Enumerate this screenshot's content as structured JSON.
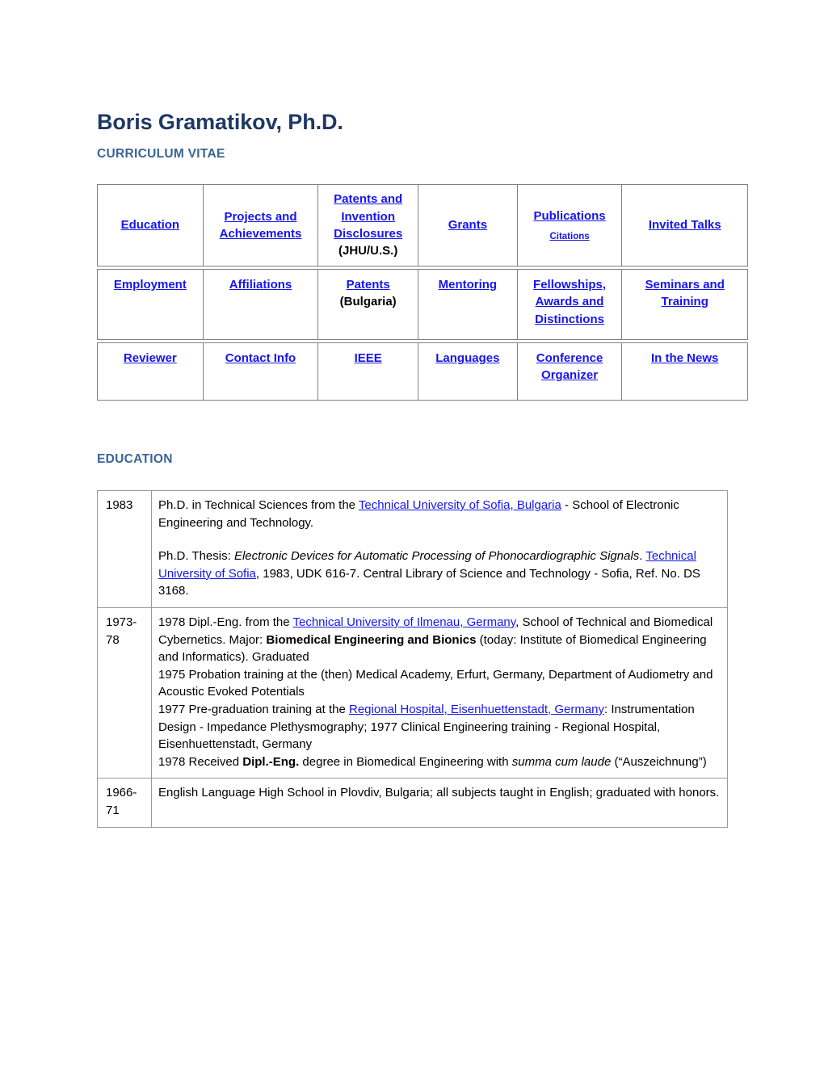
{
  "document": {
    "title": "Boris Gramatikov, Ph.D.",
    "subtitle": "CURRICULUM VITAE"
  },
  "nav_table": {
    "rows": [
      {
        "cells": [
          {
            "link": "Education"
          },
          {
            "link": "Projects and Achievements"
          },
          {
            "link": "Patents and Invention Disclosures",
            "sub": "(JHU/U.S.)"
          },
          {
            "link": "Grants"
          },
          {
            "link": "Publications",
            "small_link": "Citations"
          },
          {
            "link": "Invited Talks"
          }
        ]
      },
      {
        "cells": [
          {
            "link": "Employment"
          },
          {
            "link": "Affiliations"
          },
          {
            "link": "Patents",
            "sub": "(Bulgaria)"
          },
          {
            "link": "Mentoring"
          },
          {
            "link": "Fellowships, Awards and Distinctions"
          },
          {
            "link": "Seminars and Training"
          }
        ]
      },
      {
        "cells": [
          {
            "link": "Reviewer"
          },
          {
            "link": "Contact Info"
          },
          {
            "link": "IEEE"
          },
          {
            "link": "Languages"
          },
          {
            "link": "Conference Organizer"
          },
          {
            "link": "In the News"
          }
        ]
      }
    ]
  },
  "education": {
    "heading": "EDUCATION",
    "rows": [
      {
        "year": "1983",
        "para1": {
          "t1": "Ph.D. in Technical Sciences from the ",
          "link1": "Technical University of Sofia, Bulgaria",
          "t2": " - School of Electronic Engineering and Technology."
        },
        "para2": {
          "t1": "Ph.D. Thesis: ",
          "italic1": "Electronic Devices for Automatic Processing of Phonocardiographic Signals",
          "t2": ". ",
          "link1": "Technical University of Sofia",
          "t3": ", 1983, UDK 616-7. Central Library of Science and Technology - Sofia, Ref. No. DS 3168."
        }
      },
      {
        "year": "1973-78",
        "line1": {
          "t1": "  1978   Dipl.-Eng. from the ",
          "link1": "Technical University of Ilmenau, Germany",
          "t2": ", School of Technical and Biomedical Cybernetics. Major: ",
          "bold1": "Biomedical Engineering and Bionics",
          "t3": " (today: Institute of Biomedical Engineering and Informatics).  Graduated"
        },
        "line2": {
          "t1": "1975    Probation training at the (then) Medical Academy, Erfurt, Germany, Department of Audiometry and Acoustic Evoked Potentials"
        },
        "line3": {
          "t1": "  1977    Pre-graduation training at the ",
          "link1": "Regional Hospital, Eisenhuettenstadt, Germany",
          "t2": ": Instrumentation Design -  Impedance Plethysmography; 1977    Clinical Engineering training - Regional Hospital, Eisenhuettenstadt, Germany"
        },
        "line4": {
          "t1": "  1978    Received  ",
          "bold1": "Dipl.-Eng.",
          "t2": " degree in Biomedical Engineering with ",
          "italic1": "summa cum laude",
          "t3": "  (“Auszeichnung”)"
        }
      },
      {
        "year": "1966-71",
        "text": "English Language High School in Plovdiv, Bulgaria; all subjects taught in English; graduated with honors."
      }
    ]
  },
  "colors": {
    "title": "#1F3864",
    "heading": "#3A6496",
    "link": "#1515EE",
    "border": "#808080",
    "text": "#000000",
    "background": "#FFFFFF"
  }
}
